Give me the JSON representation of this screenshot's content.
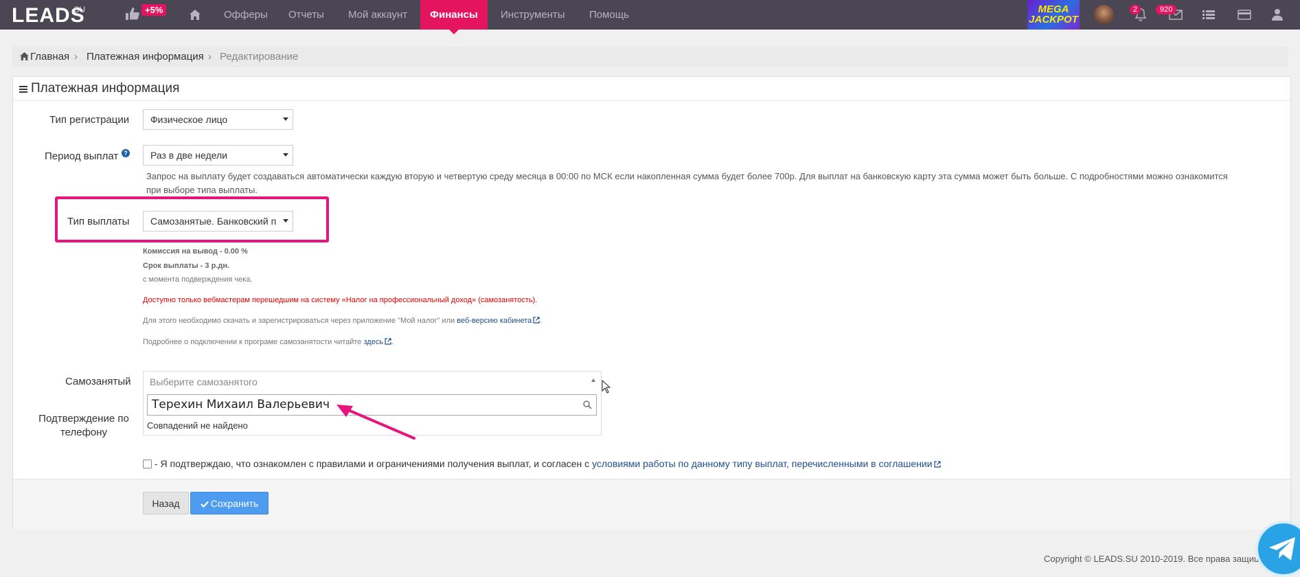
{
  "navbar": {
    "logo": "LEADS",
    "logo_sub": ".SU",
    "bonus_badge": "+5%",
    "items": [
      {
        "label": "Офферы"
      },
      {
        "label": "Отчеты"
      },
      {
        "label": "Мой аккаунт"
      },
      {
        "label": "Финансы",
        "active": true
      },
      {
        "label": "Инструменты"
      },
      {
        "label": "Помощь"
      }
    ],
    "jackpot_line1": "MEGA",
    "jackpot_line2": "JACKPOT",
    "notifications_count": "2",
    "messages_count": "920",
    "accent_color": "#e5145f",
    "bg_color": "#4a4653"
  },
  "breadcrumb": {
    "home": "Главная",
    "item1": "Платежная информация",
    "item2": "Редактирование"
  },
  "panel": {
    "title": "Платежная информация",
    "registration_type": {
      "label": "Тип регистрации",
      "value": "Физическое лицо"
    },
    "payout_period": {
      "label": "Период выплат",
      "value": "Раз в две недели",
      "hint_line1": "Запрос на выплату будет создаваться автоматически каждую вторую и четвертую среду месяца в 00:00 по МСК если накопленная сумма будет более 700р. Для выплат на банковскую карту эта сумма может быть больше. С подробностями можно ознакомится",
      "hint_line2": "при выборе типа выплаты."
    },
    "payout_type": {
      "label": "Тип выплаты",
      "value": "Самозанятые. Банковский п"
    },
    "info": {
      "commission": "Комиссия на вывод - 0.00 %",
      "term": "Срок выплаты - 3 р.дн.",
      "term_note": "с момента подверждения чека.",
      "warning": "Доступно только вебмастерам перешедшим на систему «Налог на профессиональный доход» (самозанятость).",
      "download_text": "Для этого необходимо скачать и зарегистрироваться через приложение \"Мой налог\" или ",
      "download_link": "веб-версию кабинета",
      "more_text": "Подробнее о подключении к програме самозанятости читайте ",
      "more_link": "здесь"
    },
    "self_employed": {
      "label": "Самозанятый",
      "placeholder": "Выберите самозанятого",
      "search_value": "Терехин Михаил Валерьевич",
      "no_results": "Совпадений не найдено"
    },
    "phone_confirm": {
      "label_line1": "Подтверждение по",
      "label_line2": "телефону"
    },
    "agreement": {
      "text": "- Я подтверждаю, что ознакомлен с правилами и ограничениями получения выплат, и согласен с ",
      "link": "условиями работы по данному типу выплат, перечисленными в соглашении"
    },
    "buttons": {
      "back": "Назад",
      "save": "Сохранить"
    }
  },
  "footer": {
    "copyright": "Copyright © LEADS.SU 2010-2019. Все права защищ"
  },
  "annotation_color": "#e5147e"
}
